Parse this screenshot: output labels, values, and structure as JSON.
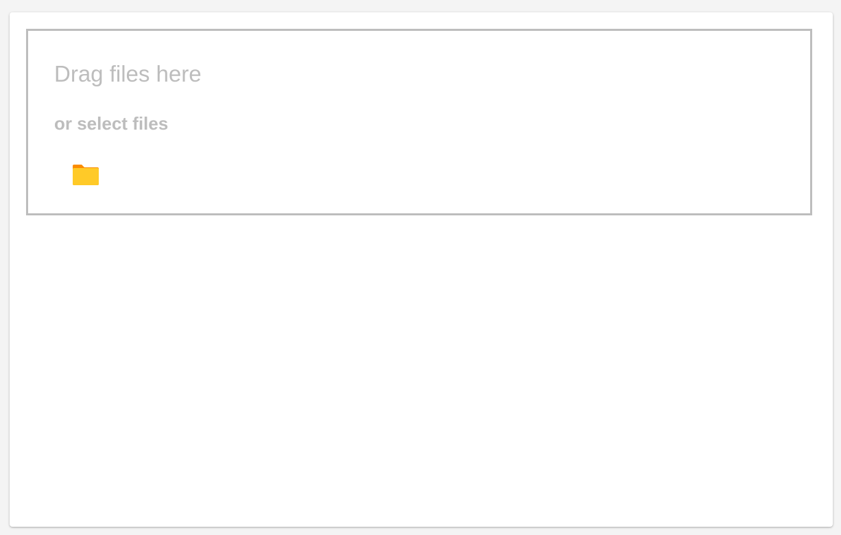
{
  "upload": {
    "title": "Drag files here",
    "select_label": "or select files",
    "folder_icon": "folder-icon"
  },
  "colors": {
    "text_muted": "#bdbdbd",
    "border": "#bdbdbd",
    "folder_front": "#ffca28",
    "folder_back": "#fb8c00"
  }
}
